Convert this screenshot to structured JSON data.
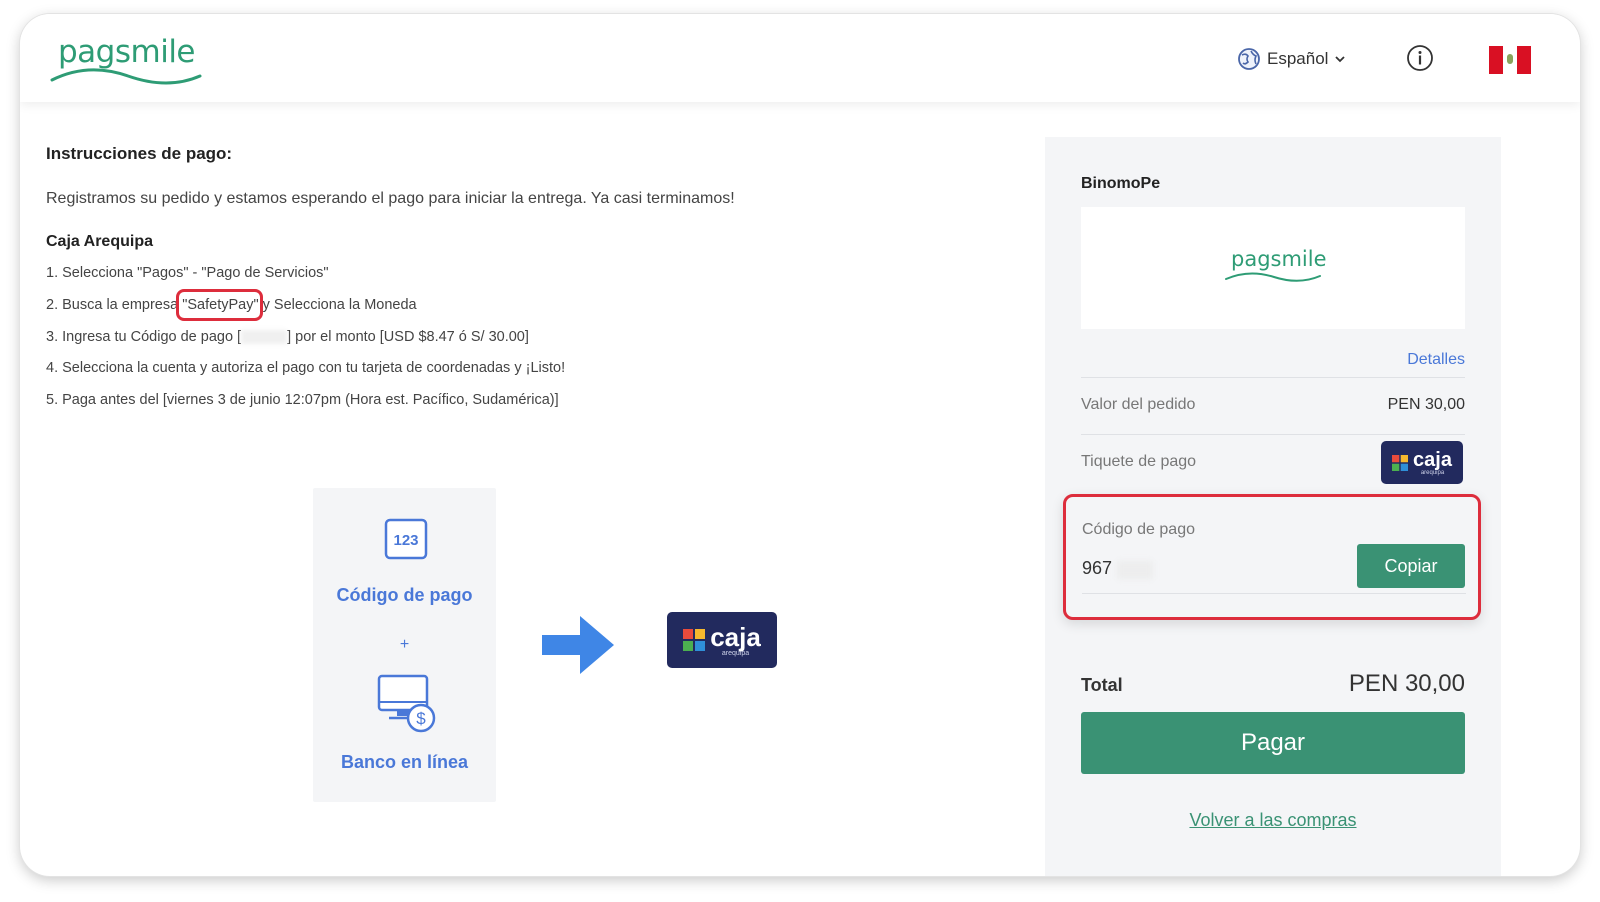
{
  "header": {
    "brand": "pagsmile",
    "language": "Español",
    "info_icon": "info-icon",
    "flag": "peru-flag-icon"
  },
  "instructions": {
    "title": "Instrucciones de pago:",
    "intro": "Registramos su pedido y estamos esperando el pago para iniciar la entrega. Ya casi terminamos!",
    "bank_name": "Caja Arequipa",
    "steps": {
      "s1": "1. Selecciona \"Pagos\" - \"Pago de Servicios\"",
      "s2_pre": "2. Busca la empresa ",
      "s2_hl": "\"SafetyPay\"",
      "s2_post": " y Selecciona la Moneda",
      "s3_pre": "3. Ingresa tu Código de pago [",
      "s3_post": "] por el monto [USD $8.47 ó S/ 30.00]",
      "s4": "4. Selecciona la cuenta y autoriza el pago con tu tarjeta de coordenadas y ¡Listo!",
      "s5": "5. Paga antes del [viernes 3 de junio 12:07pm (Hora est. Pacífico, Sudamérica)]"
    }
  },
  "diagram": {
    "code_icon_text": "123",
    "code_label": "Código de pago",
    "plus": "+",
    "bank_label": "Banco en línea",
    "caja_word": "caja",
    "caja_sub": "arequipa"
  },
  "summary": {
    "merchant": "BinomoPe",
    "merchant_logo": "pagsmile",
    "details_link": "Detalles",
    "order_value_label": "Valor del pedido",
    "order_value": "PEN 30,00",
    "ticket_label": "Tiquete de pago",
    "code_label": "Código de pago",
    "code_value": "967",
    "copy_button": "Copiar",
    "total_label": "Total",
    "total_value": "PEN 30,00",
    "pay_button": "Pagar",
    "back_link": "Volver a las compras"
  },
  "colors": {
    "brand_green": "#3a9274",
    "link_blue": "#4a78d8",
    "highlight_red": "#dd2d3c",
    "caja_navy": "#222a5e"
  }
}
